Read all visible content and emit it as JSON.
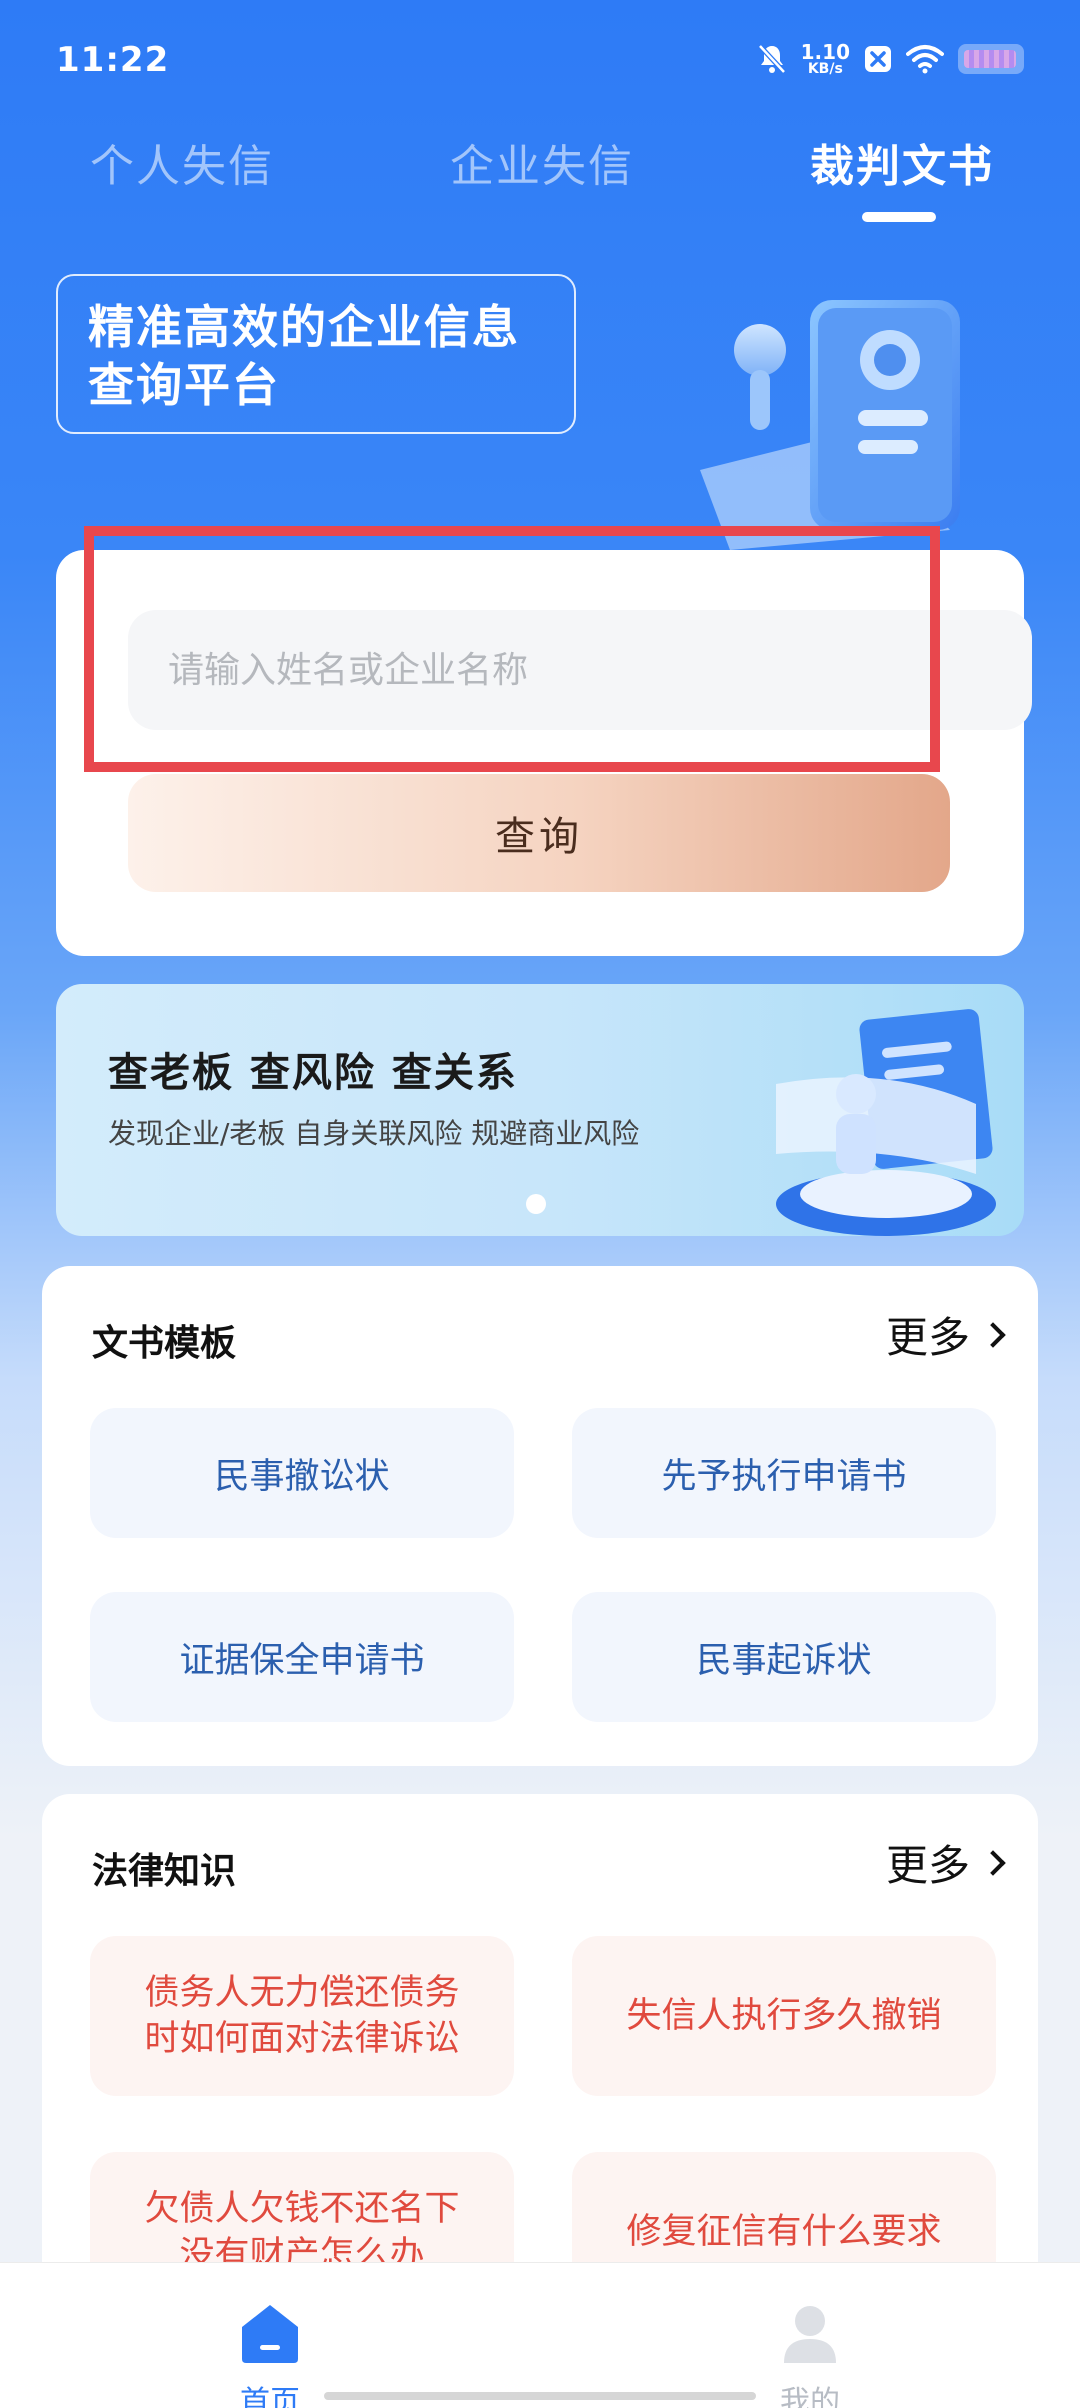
{
  "status_bar": {
    "time": "11:22",
    "net_speed_value": "1.10",
    "net_speed_unit": "KB/s",
    "icons": [
      "bell-muted-icon",
      "close-box-icon",
      "wifi-icon",
      "battery-icon"
    ]
  },
  "tabs": [
    {
      "label": "个人失信",
      "active": false
    },
    {
      "label": "企业失信",
      "active": false
    },
    {
      "label": "裁判文书",
      "active": true
    }
  ],
  "slogan": {
    "line1": "精准高效的企业信息",
    "line2": "查询平台"
  },
  "search": {
    "placeholder": "请输入姓名或企业名称",
    "value": "",
    "button_label": "查询"
  },
  "highlight_color": "#e8474d",
  "banner": {
    "title": "查老板 查风险 查关系",
    "subtitle": "发现企业/老板  自身关联风险 规避商业风险"
  },
  "doc_templates": {
    "title": "文书模板",
    "more_label": "更多",
    "items": [
      "民事撤讼状",
      "先予执行申请书",
      "证据保全申请书",
      "民事起诉状"
    ]
  },
  "legal_knowledge": {
    "title": "法律知识",
    "more_label": "更多",
    "items": [
      {
        "line1": "债务人无力偿还债务",
        "line2": "时如何面对法律诉讼"
      },
      {
        "line1": "失信人执行多久撤销",
        "line2": ""
      },
      {
        "line1": "欠债人欠钱不还名下",
        "line2": "没有财产怎么办"
      },
      {
        "line1": "修复征信有什么要求",
        "line2": ""
      }
    ]
  },
  "bottom_nav": [
    {
      "label": "首页",
      "icon": "home-icon",
      "active": true
    },
    {
      "label": "我的",
      "icon": "user-icon",
      "active": false
    }
  ],
  "colors": {
    "brand_blue": "#2e7bf6",
    "doc_tile_text": "#2b5fae",
    "law_tile_text": "#e04a3e"
  }
}
